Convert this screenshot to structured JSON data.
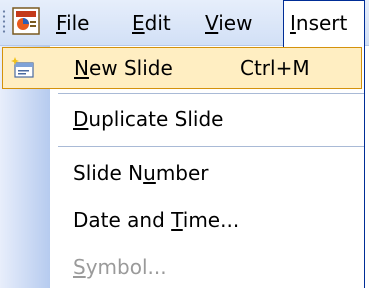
{
  "menubar": {
    "items": [
      {
        "pre": "",
        "u": "F",
        "post": "ile"
      },
      {
        "pre": "",
        "u": "E",
        "post": "dit"
      },
      {
        "pre": "",
        "u": "V",
        "post": "iew"
      },
      {
        "pre": "",
        "u": "I",
        "post": "nsert"
      }
    ],
    "app_icon": "powerpoint-icon",
    "open_menu": "Insert"
  },
  "dropdown": {
    "items": [
      {
        "pre": "",
        "u": "N",
        "post": "ew Slide",
        "shortcut": "Ctrl+M",
        "icon": "new-slide-icon",
        "state": "highlighted"
      },
      {
        "pre": "",
        "u": "D",
        "post": "uplicate Slide",
        "state": "normal"
      },
      {
        "pre": "Slide N",
        "u": "u",
        "post": "mber",
        "state": "normal"
      },
      {
        "pre": "Date and ",
        "u": "T",
        "post": "ime...",
        "state": "normal"
      },
      {
        "pre": "",
        "u": "S",
        "post": "ymbol...",
        "state": "disabled"
      }
    ]
  },
  "colors": {
    "menubar_bg": "#dbe6f8",
    "highlight_bg": "#ffeec2",
    "highlight_border": "#d4920c",
    "menu_border": "#002d96",
    "disabled_text": "#9a9a9a"
  }
}
